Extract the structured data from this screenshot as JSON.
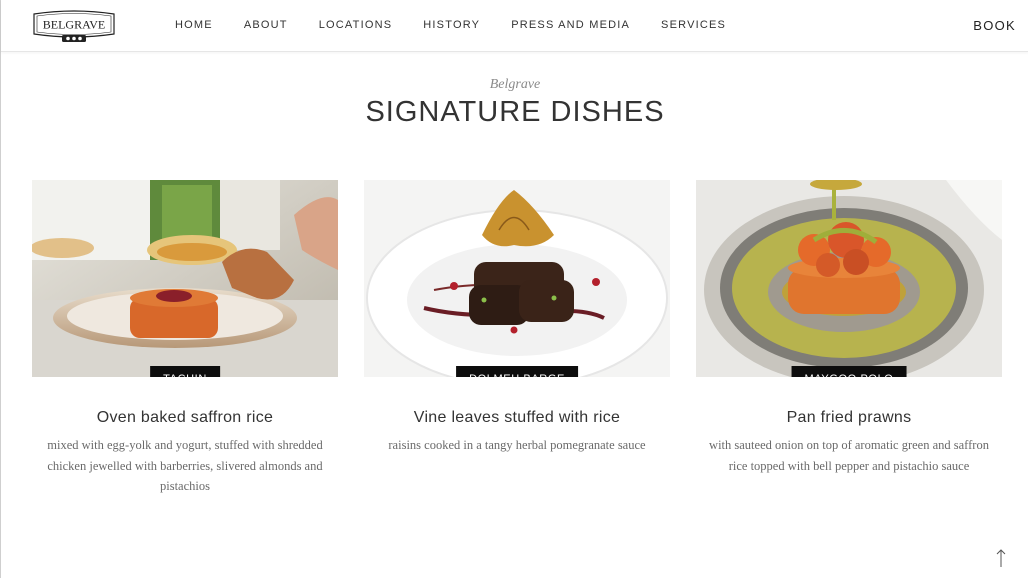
{
  "brand": {
    "logo_text": "BELGRAVE"
  },
  "nav": {
    "items": [
      {
        "label": "HOME"
      },
      {
        "label": "ABOUT"
      },
      {
        "label": "LOCATIONS"
      },
      {
        "label": "HISTORY"
      },
      {
        "label": "PRESS AND MEDIA"
      },
      {
        "label": "SERVICES"
      }
    ],
    "book_label": "BOOK"
  },
  "section": {
    "subtitle": "Belgrave",
    "title": "SIGNATURE DISHES"
  },
  "dishes": [
    {
      "tag": "TACHIN",
      "name": "Oven baked saffron rice",
      "description": "mixed with egg-yolk and yogurt, stuffed with shredded chicken jewelled with barberries, slivered almonds and pistachios"
    },
    {
      "tag": "DOLMEH BARGE",
      "name": "Vine leaves stuffed with rice",
      "description": "raisins cooked in a tangy herbal pomegranate sauce"
    },
    {
      "tag": "MAYGOO POLO",
      "name": "Pan fried prawns",
      "description": "with sauteed onion on top of aromatic green and saffron rice topped with bell pepper and pistachio sauce"
    }
  ],
  "icons": {
    "scroll_top": "arrow-up-icon",
    "logo": "belgrave-logo"
  }
}
